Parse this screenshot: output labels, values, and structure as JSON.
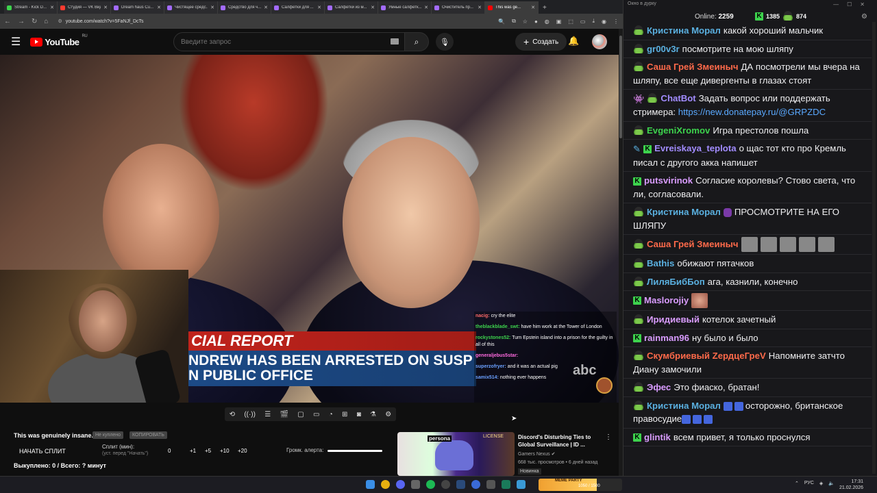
{
  "browser": {
    "tabs": [
      {
        "label": "Stream - Kick D...",
        "color": "#3dd34d"
      },
      {
        "label": "Студия — VK Вид...",
        "color": "#ff3b30"
      },
      {
        "label": "Dream haus Cu...",
        "color": "#a36bff"
      },
      {
        "label": "Чистящее средс...",
        "color": "#a36bff"
      },
      {
        "label": "Средство для ч...",
        "color": "#a36bff"
      },
      {
        "label": "Салфетки для ...",
        "color": "#a36bff"
      },
      {
        "label": "Салфетки из м...",
        "color": "#a36bff"
      },
      {
        "label": "Умные салфетк...",
        "color": "#a36bff"
      },
      {
        "label": "Очиститель пр...",
        "color": "#a36bff"
      },
      {
        "label": "This was ge...",
        "color": "#ff0000",
        "active": true
      }
    ],
    "new_tab": "+",
    "url": "youtube.com/watch?v=5FaNJf_DcTs",
    "back": "←",
    "forward": "→",
    "reload": "↻"
  },
  "youtube": {
    "logo": "YouTube",
    "region": "RU",
    "search_placeholder": "Введите запрос",
    "create_label": "Создать"
  },
  "video": {
    "banner_top": "CIAL REPORT",
    "banner_line1": "NDREW HAS BEEN ARRESTED ON SUSP",
    "banner_line2": "N PUBLIC OFFICE",
    "abc": "abc",
    "overlay_chat": [
      {
        "user": "nacig:",
        "text": "cry the elite",
        "color": "#ff6a6a"
      },
      {
        "user": "theblackblade_swt:",
        "text": "have him work at the Tower of London",
        "color": "#3dd34d"
      },
      {
        "user": "rockystones52:",
        "text": "Turn Epstein island into a prison for the guilty in all of this",
        "color": "#3dd34d"
      },
      {
        "user": "generaljebus5star:",
        "text": "",
        "color": "#ff6adf"
      },
      {
        "user": "superzofryer:",
        "text": "and it was an actual pig",
        "color": "#6aa0ff"
      },
      {
        "user": "samix514:",
        "text": "nothing ever happens",
        "color": "#6aa0ff"
      }
    ]
  },
  "split_panel": {
    "title": "This was genuinely insane...",
    "tag1": "Не куплено",
    "tag2": "КОПИРОВАТЬ",
    "start": "НАЧАТЬ СПЛИТ",
    "split_label": "Сплит (мин):",
    "split_hint": "(уст. перед \"Начать\")",
    "buttons": [
      "0",
      "+1",
      "+5",
      "+10",
      "+20"
    ],
    "volume_label": "Громк. алерта:",
    "volume_level": 1.0,
    "bought": "Выкуплено: 0 / Всего: ? минут"
  },
  "recommendation": {
    "title": "Discord's Disturbing Ties to Global Surveillance | ID ...",
    "channel": "Gamers Nexus",
    "meta": "668 тыс. просмотров • 6 дней назад",
    "badge": "Новинка",
    "thumb_label": "persona",
    "thumb_lic": "LICENSE"
  },
  "chat": {
    "window_title": "Окно в дурку",
    "online_label": "Online:",
    "online_count": "2259",
    "k_count": "1385",
    "pepe_count": "874",
    "messages": [
      {
        "name": "Кристина Морал",
        "color": "#5ab0e0",
        "text": "какой хороший мальчик",
        "icon": "pepe"
      },
      {
        "name": "gr00v3r",
        "color": "#5ab0e0",
        "text": "посмотрите на мою шляпу",
        "icon": "pepe"
      },
      {
        "name": "Саша Грей Змеиныч",
        "color": "#ff6a4a",
        "text": "ДА посмотрели мы вчера на шляпу, все еще дивергенты в глазах стоят",
        "icon": "pepe"
      },
      {
        "name": "ChatBot",
        "color": "#a28cff",
        "text": "Задать вопрос или поддержать стримера: ",
        "link": "https://new.donatepay.ru/@GRPZDC",
        "icon": "bot"
      },
      {
        "name": "EvgeniXromov",
        "color": "#3dd34d",
        "text": "Игра престолов пошла",
        "icon": "pepe"
      },
      {
        "name": "Evreiskaya_teplota",
        "color": "#a28cff",
        "text": "о щас тот кто про Кремль писал с другого акка напишет",
        "icon": "k2"
      },
      {
        "name": "putsvirinok",
        "color": "#d99cff",
        "text": "Согласие королевы? Стово света, что ли, согласовали.",
        "icon": "k"
      },
      {
        "name": "Кристина Морал",
        "color": "#5ab0e0",
        "text": "ПРОСМОТРИТЕ НА ЕГО ШЛЯПУ",
        "icon": "pepe",
        "emote": "purple"
      },
      {
        "name": "Саша Грей Змеиныч",
        "color": "#ff6a4a",
        "text": "",
        "icon": "pepe",
        "emotes": 5
      },
      {
        "name": "Bathis",
        "color": "#5ab0e0",
        "text": "обижают пятачков",
        "icon": "pepe"
      },
      {
        "name": "ЛиляБибБоп",
        "color": "#5ab0e0",
        "text": "ага, казнили, конечно",
        "icon": "pepe"
      },
      {
        "name": "Maslorojiy",
        "color": "#d99cff",
        "text": "",
        "icon": "k",
        "emotes": 1
      },
      {
        "name": "Иридиевый",
        "color": "#d99cff",
        "text": "котелок зачетный",
        "icon": "pepe"
      },
      {
        "name": "rainman96",
        "color": "#d99cff",
        "text": "ну было и было",
        "icon": "k"
      },
      {
        "name": "Скумбриевый ZердцеГреV",
        "color": "#ff6a4a",
        "text": "Напомните затчто Диану замочили",
        "icon": "pepe"
      },
      {
        "name": "Эфес",
        "color": "#d99cff",
        "text": "Это фиаско, братан!",
        "icon": "pepe"
      },
      {
        "name": "Кристина Морал",
        "color": "#5ab0e0",
        "text": "осторожно, британское правосудие",
        "icon": "pepe",
        "wheel": true
      },
      {
        "name": "glintik",
        "color": "#d99cff",
        "text": "всем привет, я только проснулся",
        "icon": "k"
      }
    ]
  },
  "taskbar": {
    "widget_label": "MEME PARTY",
    "widget_count": "1050 / 1500",
    "widget_progress": 0.7,
    "lang": "РУС",
    "time": "17:31",
    "date": "21.02.2026"
  }
}
